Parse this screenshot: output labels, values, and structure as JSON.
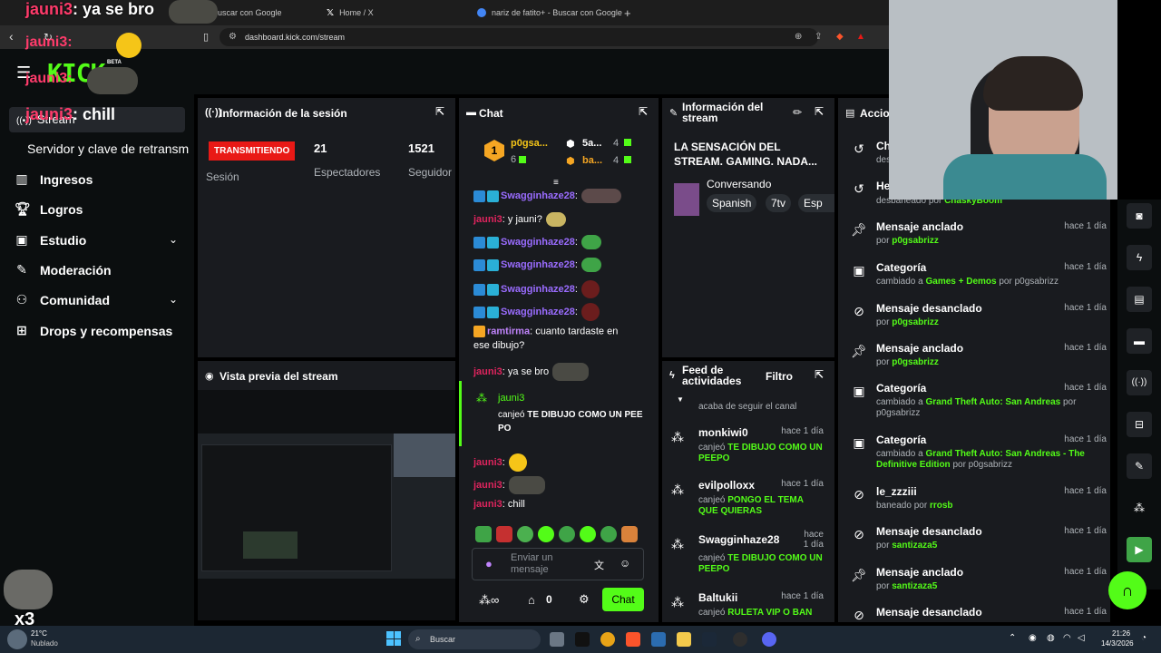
{
  "browser": {
    "tabs": [
      {
        "title": "Buscar con Google",
        "color": "#4285f4"
      },
      {
        "title": "Home / X",
        "color": "#ffffff"
      },
      {
        "title": "nariz de fatito+ - Buscar con Google",
        "color": "#4285f4"
      }
    ],
    "new_tab": "+",
    "url": "dashboard.kick.com/stream"
  },
  "overlay": {
    "msg1_user": "jauni3",
    "msg1_text": ": ya se bro",
    "msg2_user": "jauni3:",
    "msg3_user": "jauni3:",
    "msg4_user": "jauni3",
    "msg4_text": ": chill"
  },
  "kick": {
    "logo": "KICK",
    "beta": "BETA"
  },
  "sidebar": {
    "stream_label": "Stream",
    "server_key": "Servidor y clave de retransm",
    "items": [
      {
        "label": "Ingresos",
        "icon": "bar-chart-icon"
      },
      {
        "label": "Logros",
        "icon": "trophy-icon"
      },
      {
        "label": "Estudio",
        "icon": "studio-icon"
      },
      {
        "label": "Moderación",
        "icon": "wrench-icon"
      },
      {
        "label": "Comunidad",
        "icon": "community-icon"
      },
      {
        "label": "Drops y recompensas",
        "icon": "drops-icon"
      }
    ]
  },
  "session": {
    "title": "Información de la sesión",
    "live_badge": "TRANSMITIENDO",
    "session_label": "Sesión",
    "viewers_num": "21",
    "viewers_label": "Espectadores",
    "followers_num": "1521",
    "followers_label": "Seguidor"
  },
  "preview": {
    "title": "Vista previa del stream"
  },
  "chat": {
    "title": "Chat",
    "top_gifters": [
      {
        "name": "p0gsa...",
        "count": "6",
        "rank": "1"
      },
      {
        "name": "5a...",
        "count": "4",
        "rank": "2"
      },
      {
        "name": "ba...",
        "count": "4",
        "rank": "3"
      }
    ],
    "messages": [
      {
        "user": "Swagginhaze28",
        "text": ":",
        "color": "#9a6cff"
      },
      {
        "user": "jauni3",
        "text": ": y jauni?",
        "color": "#e0245e"
      },
      {
        "user": "Swagginhaze28",
        "text": ":",
        "color": "#9a6cff"
      },
      {
        "user": "Swagginhaze28",
        "text": ":",
        "color": "#9a6cff"
      },
      {
        "user": "Swagginhaze28",
        "text": ":",
        "color": "#9a6cff"
      },
      {
        "user": "Swagginhaze28",
        "text": ":",
        "color": "#9a6cff"
      },
      {
        "user": "ramtirma",
        "text": ": cuanto tardaste en",
        "color": "#c084fc"
      },
      {
        "user": "",
        "text": "ese dibujo?",
        "color": "#ffffff"
      },
      {
        "user": "jauni3",
        "text": ": ya se bro",
        "color": "#e0245e"
      }
    ],
    "redeem_user": "jauni3",
    "redeem_text": "canjeó",
    "redeem_reward": "TE DIBUJO COMO UN PEE PO",
    "after": [
      {
        "user": "jauni3",
        "text": ":"
      },
      {
        "user": "jauni3",
        "text": ":"
      },
      {
        "user": "jauni3",
        "text": ": chill"
      }
    ],
    "placeholder": "Enviar un mensaje",
    "counter": "0",
    "send_label": "Chat"
  },
  "stream_info": {
    "title": "Información del stream",
    "stream_title": "LA SENSACIÓN DEL STREAM. GAMING. NADA...",
    "category": "Conversando",
    "tags": [
      "Spanish",
      "7tv",
      "Esp"
    ]
  },
  "feed": {
    "title": "Feed de actividades",
    "filter": "Filtro",
    "first_desc": "acaba de seguir el canal",
    "rows": [
      {
        "name": "monkiwi0",
        "time": "hace 1 día",
        "action": "canjeó",
        "reward": "TE DIBUJO COMO UN PEEPO"
      },
      {
        "name": "evilpolloxx",
        "time": "hace 1 día",
        "action": "canjeó",
        "reward": "PONGO EL TEMA QUE QUIERAS"
      },
      {
        "name": "Swagginhaze28",
        "time": "hace 1 día",
        "action": "canjeó",
        "reward": "TE DIBUJO COMO UN PEEPO"
      },
      {
        "name": "Baltukii",
        "time": "hace 1 día",
        "action": "canjeó",
        "reward": "RULETA VIP O BAN"
      }
    ]
  },
  "actions": {
    "title": "Accio",
    "rows": [
      {
        "title": "Ch",
        "desc_pre": "des",
        "desc_hl": "",
        "desc_post": "",
        "time": "",
        "icon": "undo-icon"
      },
      {
        "title": "He",
        "desc_pre": "desbaneado por ",
        "desc_hl": "ChaskyBoom",
        "desc_post": "",
        "time": "",
        "icon": "undo-icon"
      },
      {
        "title": "Mensaje anclado",
        "desc_pre": "por ",
        "desc_hl": "p0gsabrizz",
        "desc_post": "",
        "time": "hace 1 día",
        "icon": "pin-icon"
      },
      {
        "title": "Categoría",
        "desc_pre": "cambiado a ",
        "desc_hl": "Games + Demos",
        "desc_post": " por p0gsabrizz",
        "time": "hace 1 día",
        "icon": "category-icon"
      },
      {
        "title": "Mensaje desanclado",
        "desc_pre": "por ",
        "desc_hl": "p0gsabrizz",
        "desc_post": "",
        "time": "hace 1 día",
        "icon": "unpin-icon"
      },
      {
        "title": "Mensaje anclado",
        "desc_pre": "por ",
        "desc_hl": "p0gsabrizz",
        "desc_post": "",
        "time": "hace 1 día",
        "icon": "pin-icon"
      },
      {
        "title": "Categoría",
        "desc_pre": "cambiado a ",
        "desc_hl": "Grand Theft Auto: San Andreas",
        "desc_post": " por p0gsabrizz",
        "time": "hace 1 día",
        "icon": "category-icon"
      },
      {
        "title": "Categoría",
        "desc_pre": "cambiado a ",
        "desc_hl": "Grand Theft Auto: San Andreas - The Definitive Edition",
        "desc_post": " por p0gsabrizz",
        "time": "hace 1 día",
        "icon": "category-icon"
      },
      {
        "title": "le_zzziii",
        "desc_pre": "baneado por ",
        "desc_hl": "rrosb",
        "desc_post": "",
        "time": "hace 1 día",
        "icon": "ban-icon"
      },
      {
        "title": "Mensaje desanclado",
        "desc_pre": "por ",
        "desc_hl": "santizaza5",
        "desc_post": "",
        "time": "hace 1 día",
        "icon": "unpin-icon"
      },
      {
        "title": "Mensaje anclado",
        "desc_pre": "por ",
        "desc_hl": "santizaza5",
        "desc_post": "",
        "time": "hace 1 día",
        "icon": "pin-icon"
      },
      {
        "title": "Mensaje desanclado",
        "desc_pre": "",
        "desc_hl": "",
        "desc_post": "",
        "time": "hace 1 día",
        "icon": "unpin-icon"
      }
    ]
  },
  "taskbar": {
    "weather_temp": "21°C",
    "weather_desc": "Nublado",
    "search": "Buscar",
    "time": "21:26",
    "date": "14/3/2026",
    "overlay_counter": "x3"
  },
  "colors": {
    "kick_green": "#53fc18",
    "live_red": "#e91916",
    "panel_bg": "#191b1f"
  }
}
